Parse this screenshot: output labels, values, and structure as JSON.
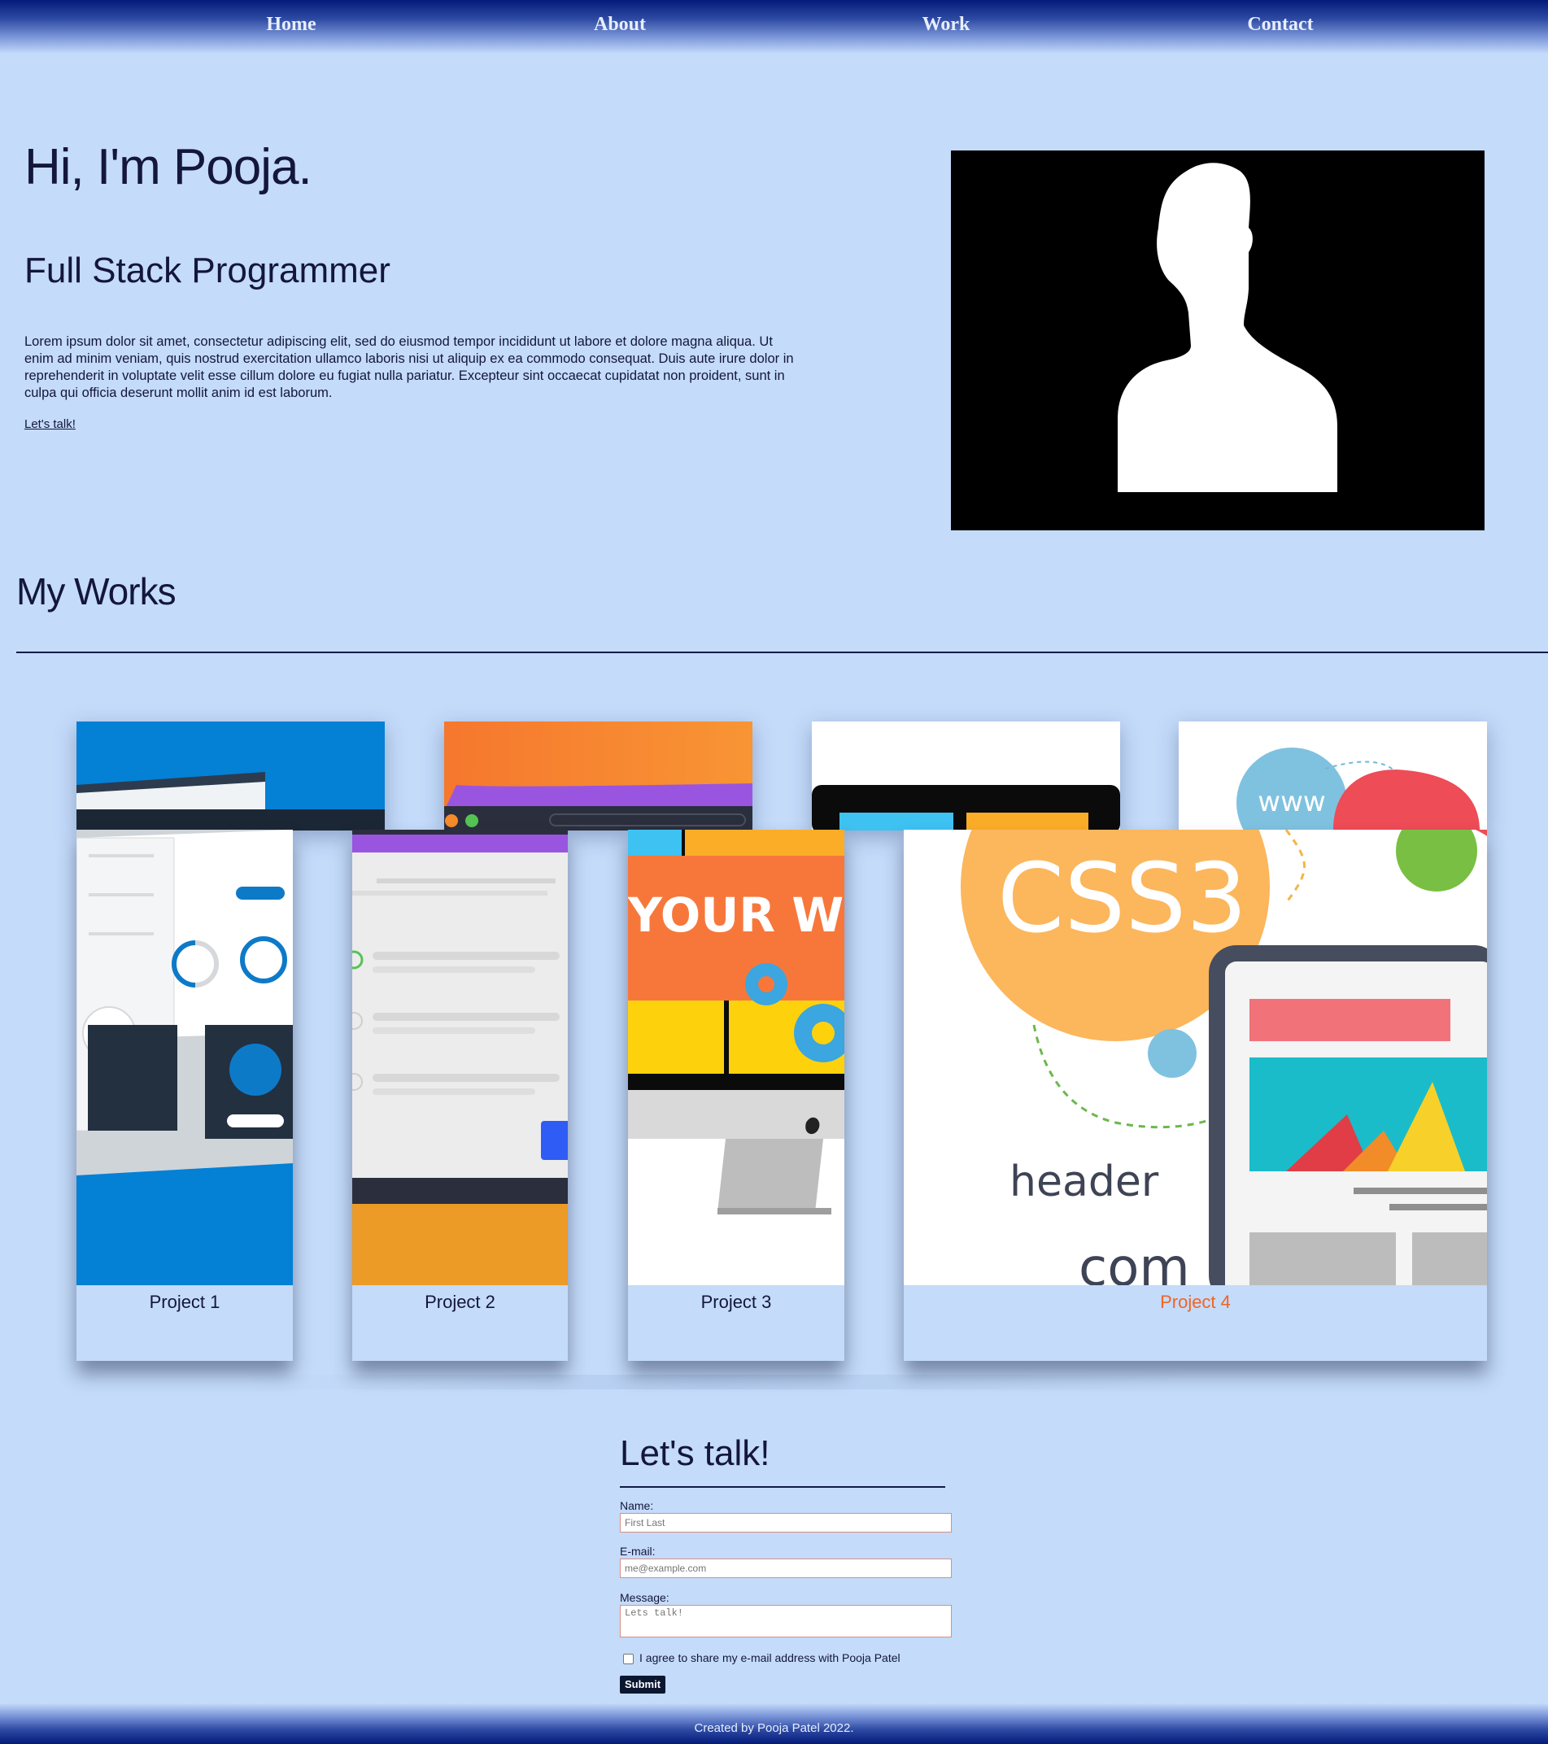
{
  "nav": {
    "items": [
      "Home",
      "About",
      "Work",
      "Contact"
    ]
  },
  "hero": {
    "title": "Hi, I'm Pooja.",
    "subtitle": "Full Stack Programmer",
    "body": "Lorem ipsum dolor sit amet, consectetur adipiscing elit, sed do eiusmod tempor incididunt ut labore et dolore magna aliqua. Ut enim ad minim veniam, quis nostrud exercitation ullamco laboris nisi ut aliquip ex ea commodo consequat. Duis aute irure dolor in reprehenderit in voluptate velit esse cillum dolore eu fugiat nulla pariatur. Excepteur sint occaecat cupidatat non proident, sunt in culpa qui officia deserunt mollit anim id est laborum.",
    "cta": "Let's talk!"
  },
  "works": {
    "title": "My Works",
    "projects": [
      {
        "label": "Project 1",
        "active": false
      },
      {
        "label": "Project 2",
        "active": false
      },
      {
        "label": "Project 3",
        "active": false
      },
      {
        "label": "Project 4",
        "active": true
      }
    ],
    "image_text": {
      "css3": "CSS3",
      "header": "header",
      "com": "com",
      "www": "www",
      "yourweb": "YOUR WE"
    }
  },
  "contact": {
    "title": "Let's talk!",
    "name_label": "Name:",
    "name_placeholder": "First Last",
    "email_label": "E-mail:",
    "email_placeholder": "me@example.com",
    "message_label": "Message:",
    "message_placeholder": "Lets talk!",
    "consent": "I agree to share my e-mail address with Pooja Patel",
    "submit": "Submit"
  },
  "footer": {
    "text": "Created by Pooja Patel 2022."
  },
  "colors": {
    "background": "#c4dbfa",
    "nav_dark": "#031a7a",
    "text": "#14163b",
    "accent_active": "#f06424",
    "submit_bg": "#0b1731"
  }
}
